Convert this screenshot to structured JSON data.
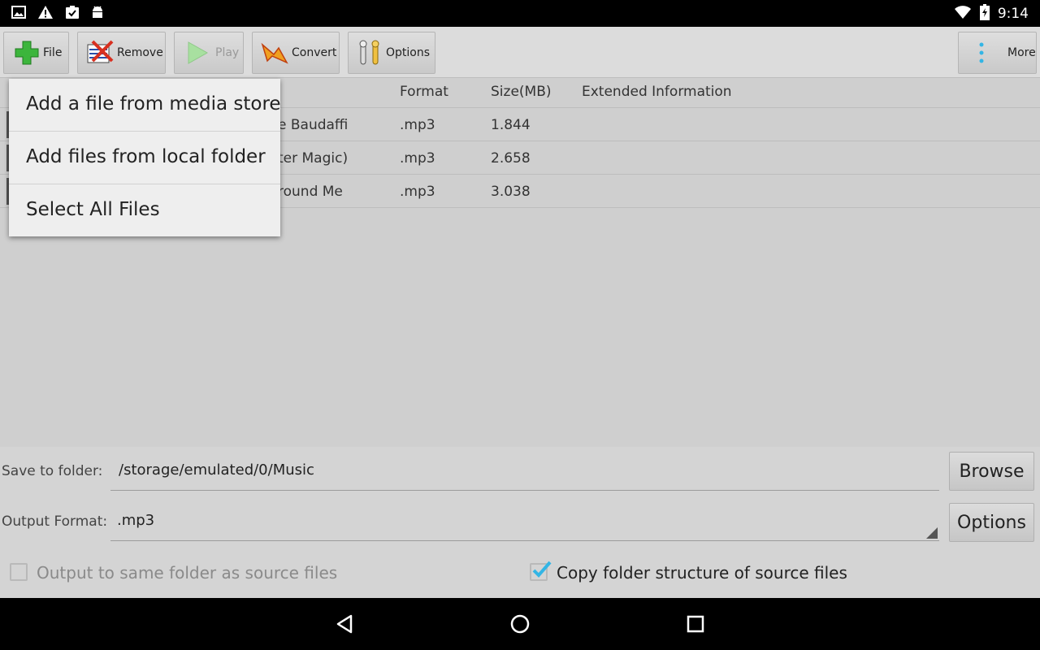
{
  "status_bar": {
    "time": "9:14",
    "left_icons": [
      "image-icon",
      "warning-icon",
      "clipboard-check-icon",
      "android-icon"
    ],
    "right_icons": [
      "wifi-icon",
      "battery-charging-icon"
    ]
  },
  "toolbar": {
    "file_label": "File",
    "remove_label": "Remove",
    "play_label": "Play",
    "convert_label": "Convert",
    "options_label": "Options",
    "more_label": "More"
  },
  "table": {
    "columns": [
      "Format",
      "Size(MB)",
      "Extended Information"
    ],
    "rows": [
      {
        "name": "e Baudaffi",
        "format": ".mp3",
        "size": "1.844",
        "extended": ""
      },
      {
        "name": "ter Magic)",
        "format": ".mp3",
        "size": "2.658",
        "extended": ""
      },
      {
        "name": "round Me",
        "format": ".mp3",
        "size": "3.038",
        "extended": ""
      }
    ]
  },
  "file_menu": {
    "items": [
      "Add a file from media store",
      "Add files from local folder",
      "Select All Files"
    ]
  },
  "output_panel": {
    "save_folder_label": "Save to folder:",
    "save_folder_value": "/storage/emulated/0/Music",
    "browse_label": "Browse",
    "output_format_label": "Output Format:",
    "output_format_value": ".mp3",
    "options_label": "Options",
    "same_folder_label": "Output to same folder as source files",
    "same_folder_checked": false,
    "copy_structure_label": "Copy folder structure of source files",
    "copy_structure_checked": true
  },
  "colors": {
    "accent": "#33b5e5",
    "background": "#cfcfcf"
  }
}
